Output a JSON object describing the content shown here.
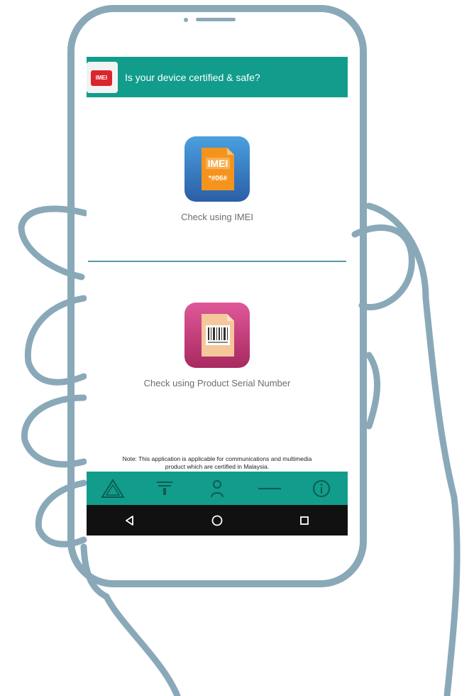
{
  "app": {
    "title": "Is your device certified & safe?",
    "logo_text": "IMEI"
  },
  "options": {
    "imei": {
      "label": "Check using IMEI",
      "icon": "imei-doc-icon",
      "icon_text": "IMEI"
    },
    "serial": {
      "label": "Check using Product Serial Number",
      "icon": "barcode-icon"
    }
  },
  "note": {
    "line1": "Note: This application is applicable for communications and multimedia",
    "line2": "product which are certified in Malaysia."
  },
  "bottom_bar": {
    "icons": [
      "mcmc-logo-icon",
      "filter-icon",
      "person-icon",
      "dash-icon",
      "info-icon"
    ]
  },
  "nav": {
    "icons": [
      "back-icon",
      "home-icon",
      "recents-icon"
    ]
  },
  "colors": {
    "teal": "#129c8b",
    "phone_outline": "#8aa9b8",
    "imei_orange": "#f5941d",
    "imei_blue": "#3a7cc0",
    "serial_pink": "#c23b7a"
  }
}
